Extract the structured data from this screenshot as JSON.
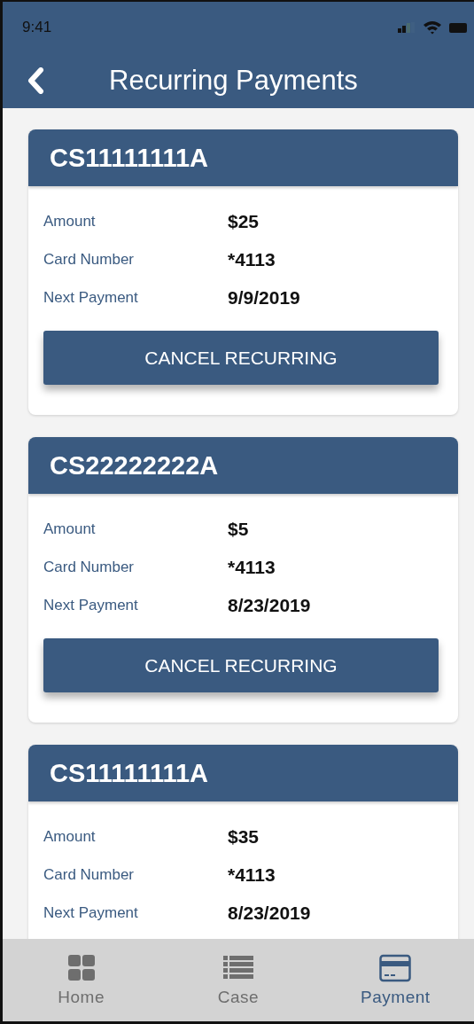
{
  "status_bar": {
    "time": "9:41"
  },
  "nav_bar": {
    "title": "Recurring Payments"
  },
  "payments": [
    {
      "case_id": "CS11111111A",
      "fields": [
        {
          "label": "Amount",
          "value": "$25"
        },
        {
          "label": "Card Number",
          "value": "*4113"
        },
        {
          "label": "Next Payment",
          "value": "9/9/2019"
        }
      ],
      "button": "CANCEL RECURRING"
    },
    {
      "case_id": "CS22222222A",
      "fields": [
        {
          "label": "Amount",
          "value": "$5"
        },
        {
          "label": "Card Number",
          "value": "*4113"
        },
        {
          "label": "Next Payment",
          "value": "8/23/2019"
        }
      ],
      "button": "CANCEL RECURRING"
    },
    {
      "case_id": "CS11111111A",
      "fields": [
        {
          "label": "Amount",
          "value": "$35"
        },
        {
          "label": "Card Number",
          "value": "*4113"
        },
        {
          "label": "Next Payment",
          "value": "8/23/2019"
        }
      ]
    }
  ],
  "tab_bar": [
    {
      "label": "Home",
      "kind": "home",
      "selected": false
    },
    {
      "label": "Case",
      "kind": "case",
      "selected": false
    },
    {
      "label": "Payment",
      "kind": "payment",
      "selected": true
    }
  ]
}
